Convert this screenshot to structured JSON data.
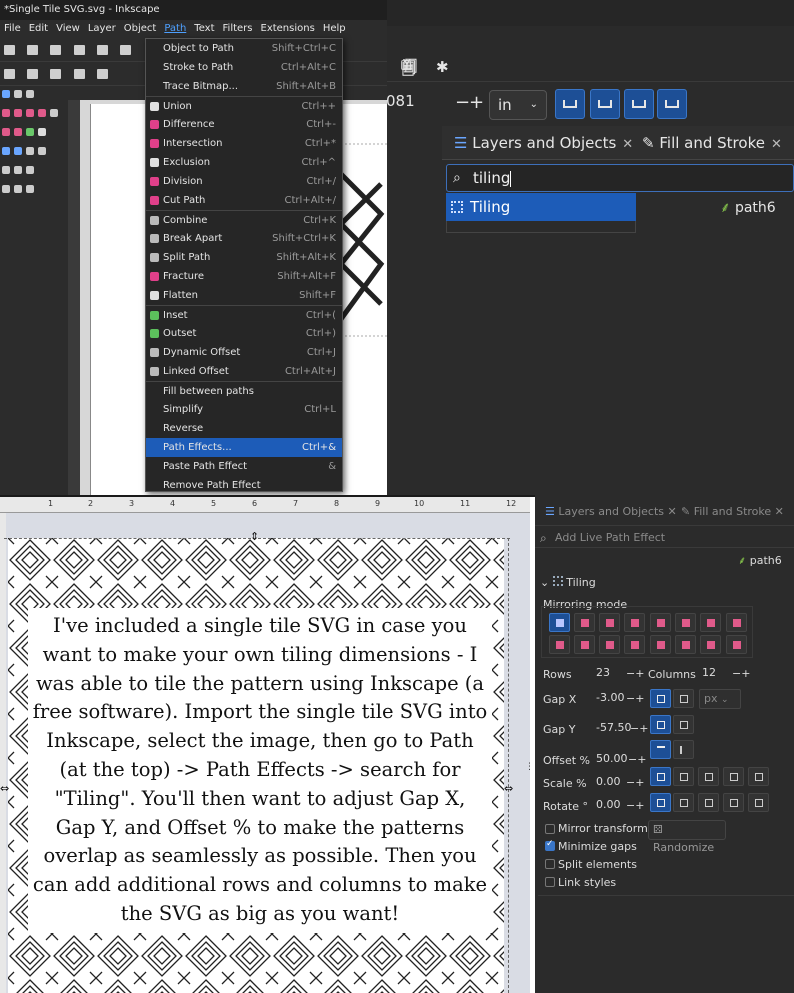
{
  "app": {
    "window_title": "*Single Tile SVG.svg - Inkscape",
    "menus": [
      "File",
      "Edit",
      "View",
      "Layer",
      "Object",
      "Path",
      "Text",
      "Filters",
      "Extensions",
      "Help"
    ],
    "active_menu": "Path"
  },
  "path_menu": {
    "items": [
      {
        "label": "Object to Path",
        "shortcut": "Shift+Ctrl+C"
      },
      {
        "label": "Stroke to Path",
        "shortcut": "Ctrl+Alt+C"
      },
      {
        "label": "Trace Bitmap...",
        "shortcut": "Shift+Alt+B"
      },
      {
        "label": "Union",
        "shortcut": "Ctrl++"
      },
      {
        "label": "Difference",
        "shortcut": "Ctrl+-"
      },
      {
        "label": "Intersection",
        "shortcut": "Ctrl+*"
      },
      {
        "label": "Exclusion",
        "shortcut": "Ctrl+^"
      },
      {
        "label": "Division",
        "shortcut": "Ctrl+/"
      },
      {
        "label": "Cut Path",
        "shortcut": "Ctrl+Alt+/"
      },
      {
        "label": "Combine",
        "shortcut": "Ctrl+K"
      },
      {
        "label": "Break Apart",
        "shortcut": "Shift+Ctrl+K"
      },
      {
        "label": "Split Path",
        "shortcut": "Shift+Alt+K"
      },
      {
        "label": "Fracture",
        "shortcut": "Shift+Alt+F"
      },
      {
        "label": "Flatten",
        "shortcut": "Shift+F"
      },
      {
        "label": "Inset",
        "shortcut": "Ctrl+("
      },
      {
        "label": "Outset",
        "shortcut": "Ctrl+)"
      },
      {
        "label": "Dynamic Offset",
        "shortcut": "Ctrl+J"
      },
      {
        "label": "Linked Offset",
        "shortcut": "Ctrl+Alt+J"
      },
      {
        "label": "Fill between paths",
        "shortcut": ""
      },
      {
        "label": "Simplify",
        "shortcut": "Ctrl+L"
      },
      {
        "label": "Reverse",
        "shortcut": ""
      },
      {
        "label": "Path Effects...",
        "shortcut": "Ctrl+&"
      },
      {
        "label": "Paste Path Effect",
        "shortcut": "&"
      },
      {
        "label": "Remove Path Effect",
        "shortcut": ""
      }
    ]
  },
  "toolbar_right": {
    "unit_value_partial": "081",
    "unit_select": "in"
  },
  "dock_top": {
    "tab_layers": "Layers and Objects",
    "tab_fill": "Fill and Stroke",
    "search_value": "tiling",
    "result": "Tiling",
    "object": "path6"
  },
  "ruler_labels": [
    "1",
    "2",
    "3",
    "4",
    "5",
    "6",
    "7",
    "8",
    "9",
    "10",
    "11",
    "12"
  ],
  "instructions": "I've included a single tile SVG in case you want to make your own tiling dimensions - I was able to tile the pattern using Inkscape (a free software). Import the single tile SVG into Inkscape, select the image, then go to Path (at the top) -> Path Effects -> search for \"Tiling\". You'll then want to adjust Gap X, Gap Y, and Offset % to make the patterns overlap as seamlessly as possible. Then you can add additional rows and columns to make the SVG as big as you want!",
  "dock_bottom": {
    "tab_layers": "Layers and Objects",
    "tab_fill": "Fill and Stroke",
    "search_placeholder": "Add Live Path Effect",
    "object": "path6",
    "effect_name": "Tiling",
    "mirroring_label": "Mirroring mode",
    "rows_label": "Rows",
    "rows_value": "23",
    "columns_label": "Columns",
    "columns_value": "12",
    "gapx_label": "Gap X",
    "gapx_value": "-3.00",
    "gap_unit": "px",
    "gapy_label": "Gap Y",
    "gapy_value": "-57.50",
    "offset_label": "Offset %",
    "offset_value": "50.00",
    "scale_label": "Scale %",
    "scale_value": "0.00",
    "rotate_label": "Rotate °",
    "rotate_value": "0.00",
    "mirror_transforms": "Mirror transforms",
    "randomize": "Randomize",
    "minimize_gaps": "Minimize gaps",
    "split_elements": "Split elements",
    "link_styles": "Link styles",
    "minimize_gaps_checked": true
  },
  "colors": {
    "accent": "#1d5cb8",
    "dark_bg": "#2b2b2b",
    "menu_bg": "#262626"
  }
}
